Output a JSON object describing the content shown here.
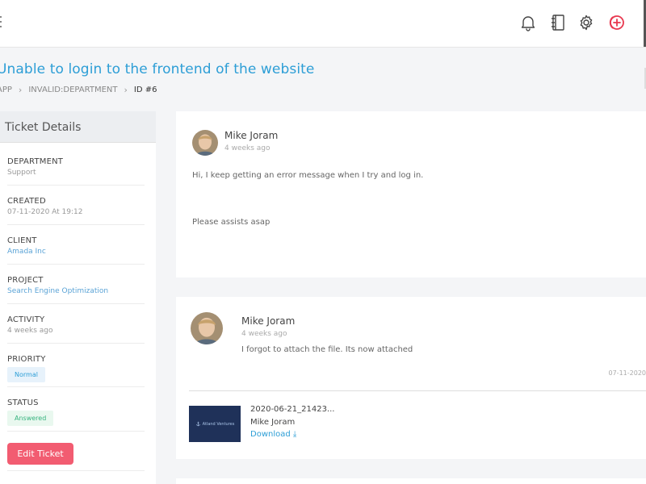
{
  "topbar": {
    "icons": [
      "bell-icon",
      "notebook-icon",
      "gear-icon",
      "add-circle-icon"
    ],
    "accent_color": "#e8384f"
  },
  "page": {
    "title": "Unable to login to the frontend of the website",
    "breadcrumb": [
      "APP",
      "INVALID:DEPARTMENT",
      "ID #6"
    ]
  },
  "ticket_details": {
    "header": "Ticket Details",
    "department": {
      "label": "DEPARTMENT",
      "value": "Support"
    },
    "created": {
      "label": "CREATED",
      "value": "07-11-2020 At 19:12"
    },
    "client": {
      "label": "CLIENT",
      "value": "Amada Inc"
    },
    "project": {
      "label": "PROJECT",
      "value": "Search Engine Optimization"
    },
    "activity": {
      "label": "ACTIVITY",
      "value": "4 weeks ago"
    },
    "priority": {
      "label": "PRIORITY",
      "value": "Normal"
    },
    "status": {
      "label": "STATUS",
      "value": "Answered"
    },
    "edit_button": "Edit Ticket"
  },
  "messages": [
    {
      "author": "Mike Joram",
      "time": "4 weeks ago",
      "body_line1": "Hi, I keep getting an error message when I try and log in.",
      "body_line2": "Please assists asap"
    },
    {
      "author": "Mike Joram",
      "time": "4 weeks ago",
      "body": "I forgot to attach the file. Its now attached",
      "date": "07-11-2020",
      "attachment": {
        "filename": "2020-06-21_21423...",
        "author": "Mike Joram",
        "download_label": "Download",
        "thumb_text": "Atland Ventures"
      }
    }
  ],
  "colors": {
    "link": "#2d9ed6",
    "edit_button": "#f25c71",
    "priority_badge": "#e7f2fb",
    "status_badge": "#e9f8ef"
  }
}
